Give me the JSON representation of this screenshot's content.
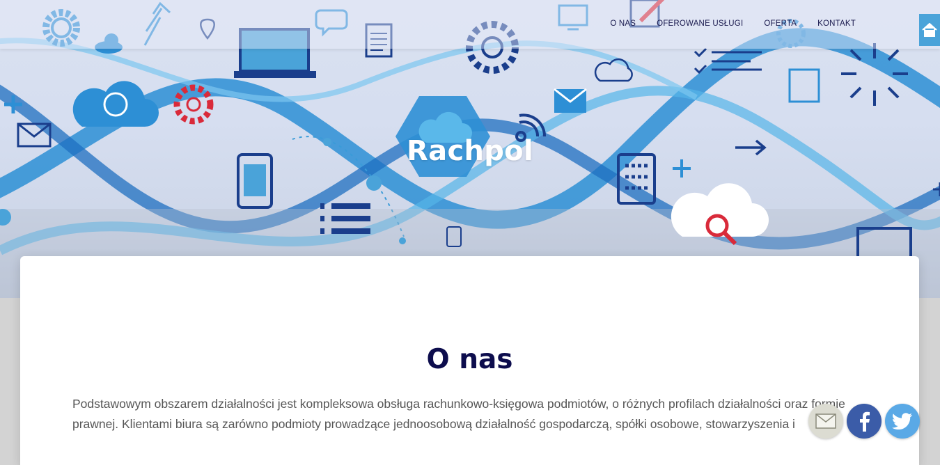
{
  "nav": {
    "items": [
      "O nas",
      "Oferowane usługi",
      "Oferta",
      "Kontakt"
    ]
  },
  "hero": {
    "title": "Rachpol"
  },
  "about": {
    "heading": "O nas",
    "body": "Podstawowym obszarem działalności jest kompleksowa obsługa rachunkowo-księgowa podmiotów, o różnych profilach działalności oraz formie prawnej. Klientami biura są zarówno podmioty prowadzące jednoosobową działalność gospodarczą, spółki osobowe, stowarzyszenia i"
  },
  "social": {
    "icons": [
      "email-icon",
      "facebook-icon",
      "twitter-icon"
    ]
  },
  "colors": {
    "accent_blue": "#2d8fd5",
    "dark_navy": "#0d0d4d",
    "red_icon": "#d92a3a",
    "facebook": "#3b5ca8",
    "twitter": "#5aa9e6"
  }
}
